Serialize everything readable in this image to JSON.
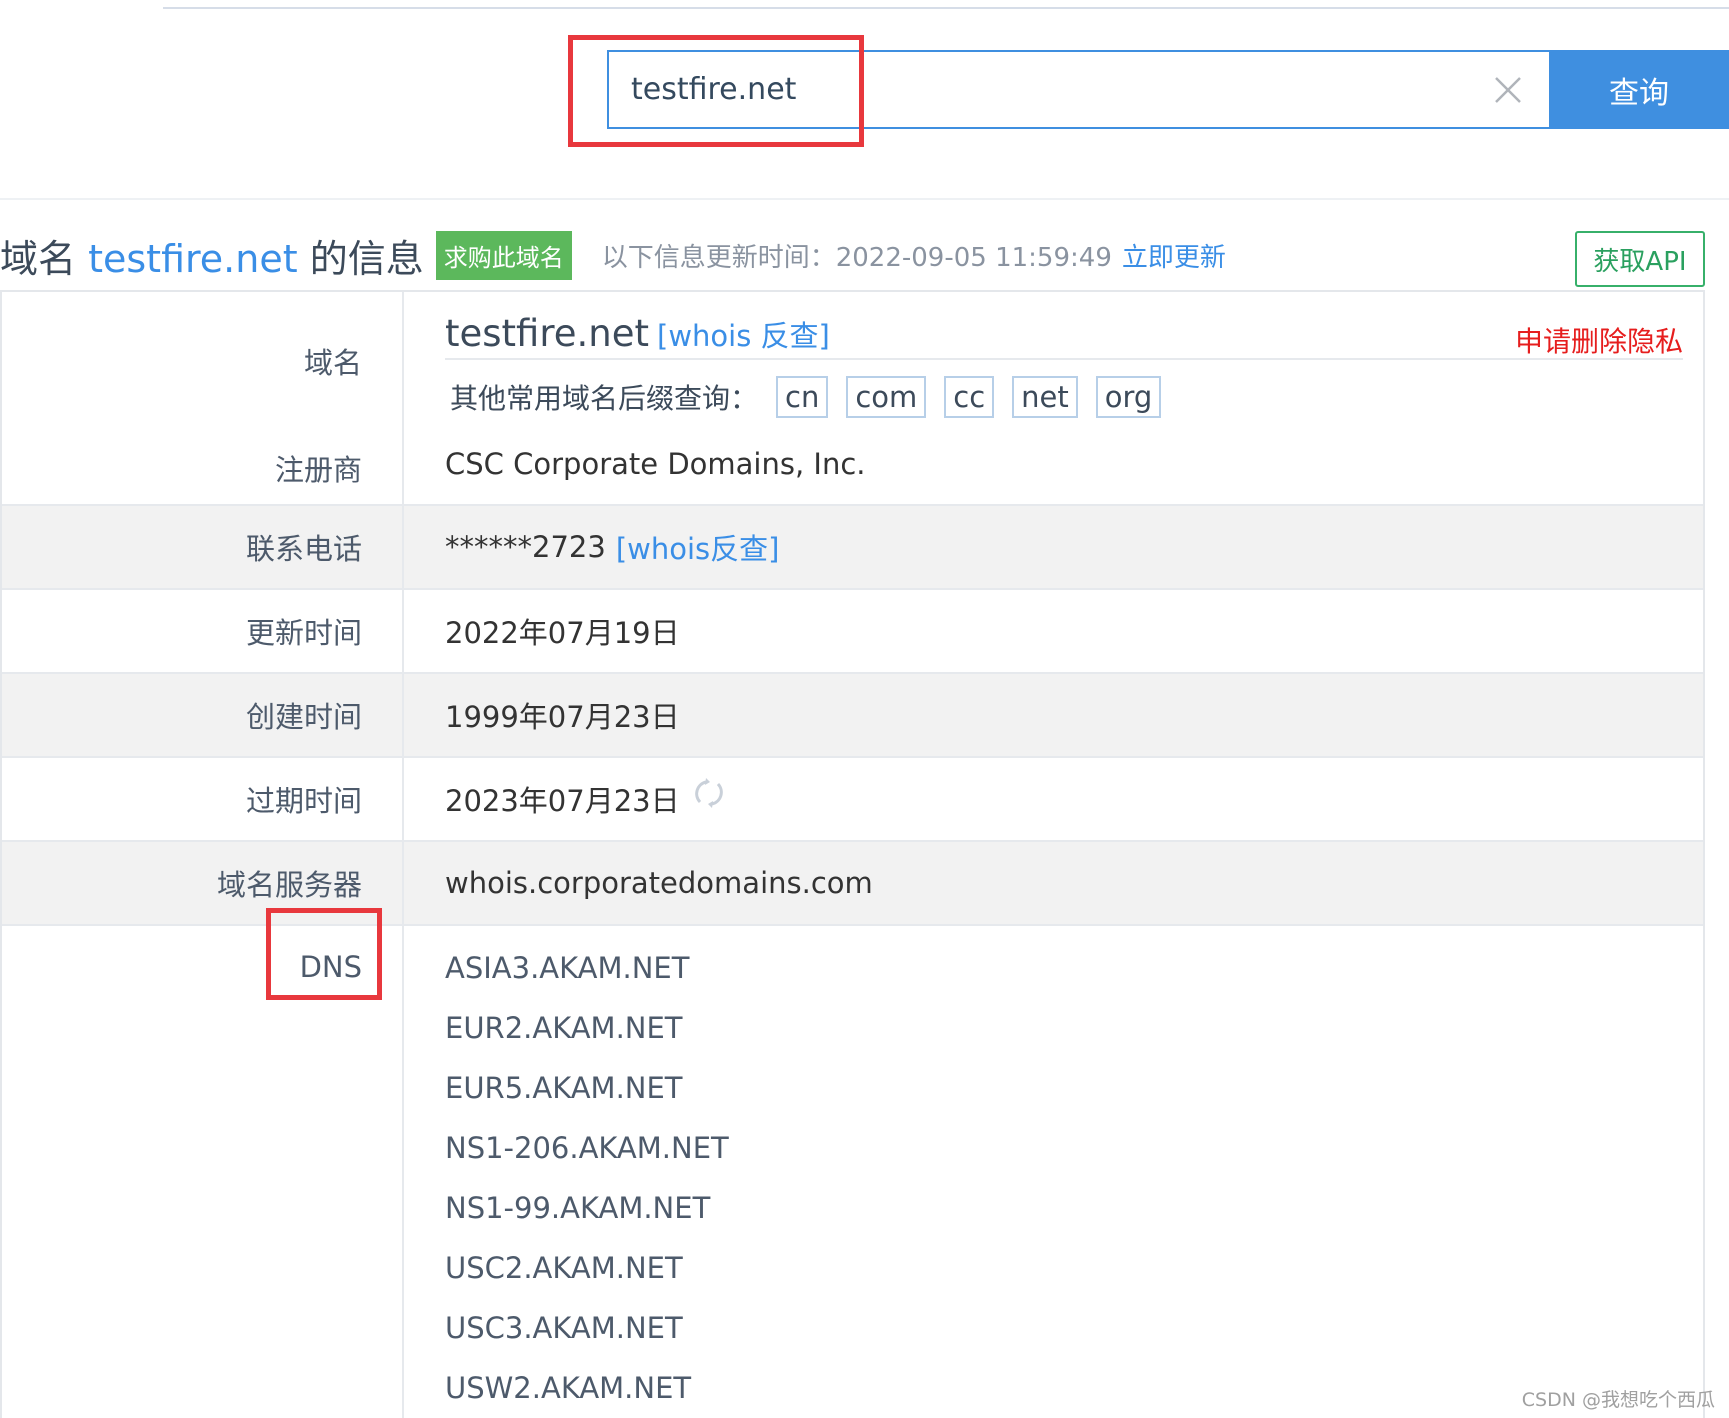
{
  "search": {
    "value": "testfire.net",
    "button_label": "查询"
  },
  "header": {
    "title_prefix": "域名 ",
    "domain": "testfire.net",
    "title_suffix": " 的信息",
    "buy_label": "求购此域名",
    "update_text": "以下信息更新时间：2022-09-05 11:59:49",
    "update_link": "立即更新",
    "api_label": "获取API"
  },
  "whois": {
    "domain_label": "域名",
    "domain_value": "testfire.net",
    "domain_whois_link": "[whois 反查]",
    "privacy_link": "申请删除隐私",
    "suffix_prompt": "其他常用域名后缀查询：",
    "suffixes": [
      "cn",
      "com",
      "cc",
      "net",
      "org"
    ],
    "registrar_label": "注册商",
    "registrar_value": "CSC Corporate Domains, Inc.",
    "phone_label": "联系电话",
    "phone_value": "******2723",
    "phone_whois_link": "[whois反查]",
    "updated_label": "更新时间",
    "updated_value": "2022年07月19日",
    "created_label": "创建时间",
    "created_value": "1999年07月23日",
    "expires_label": "过期时间",
    "expires_value": "2023年07月23日",
    "server_label": "域名服务器",
    "server_value": "whois.corporatedomains.com",
    "dns_label": "DNS",
    "dns": [
      "ASIA3.AKAM.NET",
      "EUR2.AKAM.NET",
      "EUR5.AKAM.NET",
      "NS1-206.AKAM.NET",
      "NS1-99.AKAM.NET",
      "USC2.AKAM.NET",
      "USC3.AKAM.NET",
      "USW2.AKAM.NET"
    ]
  },
  "watermark": "CSDN @我想吃个西瓜",
  "colors": {
    "accent": "#3f8fe0",
    "link": "#3a8ee6",
    "buy_badge": "#5cb85c",
    "api_border": "#37b06a",
    "privacy": "#e61e1e",
    "annotation_box": "#e8383d"
  },
  "icons": {
    "clear": "close-icon",
    "refresh": "refresh-icon"
  }
}
